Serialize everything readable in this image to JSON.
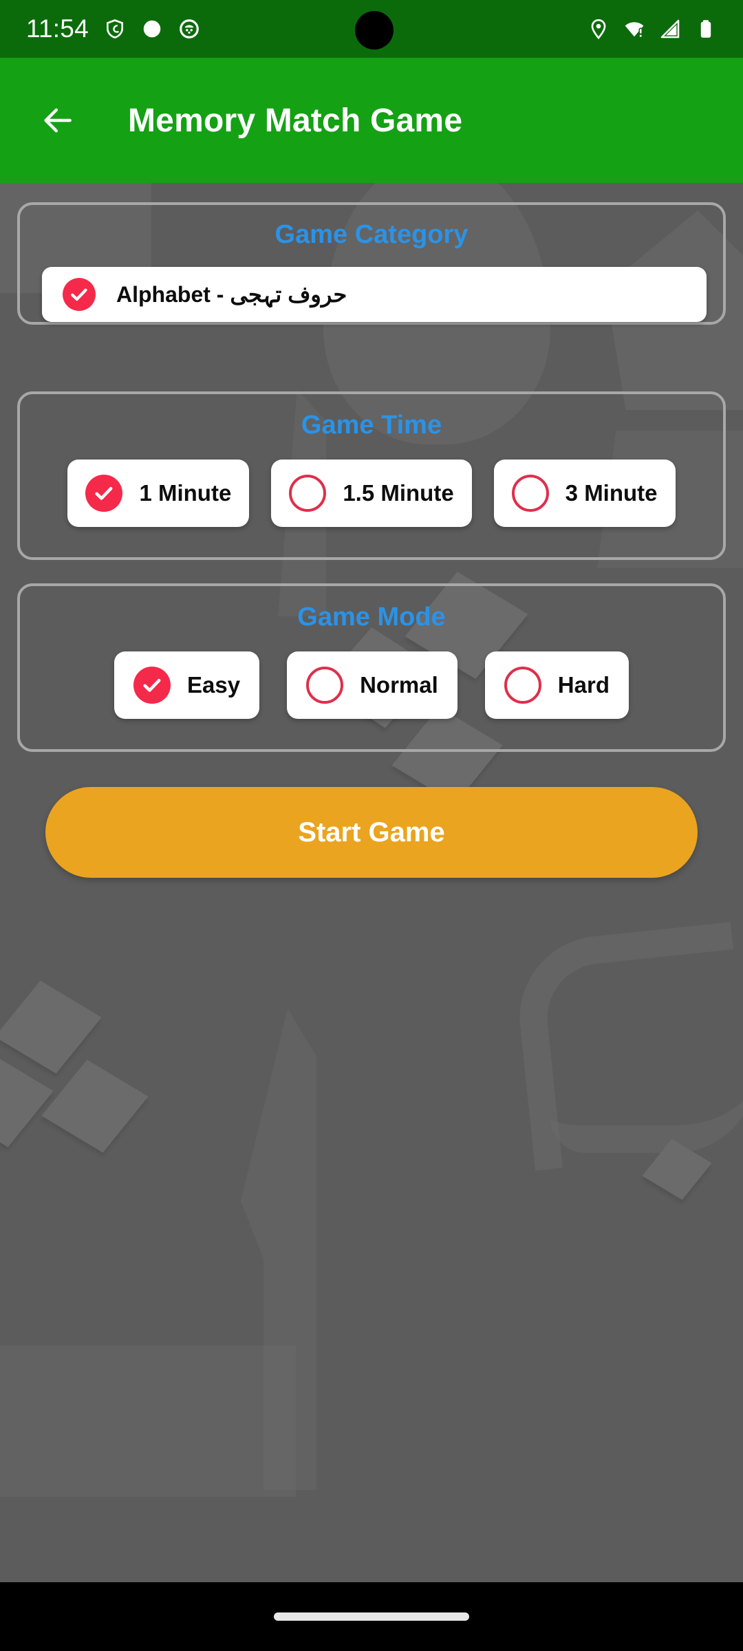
{
  "status_bar": {
    "clock": "11:54",
    "left_icons": [
      "shield-icon",
      "circle-filled-icon",
      "app-badge-icon"
    ],
    "right_icons": [
      "location-pin-icon",
      "wifi-warning-icon",
      "cell-signal-icon",
      "battery-icon"
    ]
  },
  "app_bar": {
    "back_icon": "arrow-left-icon",
    "title": "Memory Match Game",
    "background_color": "#14a114"
  },
  "sections": {
    "category": {
      "title": "Game Category",
      "options": [
        {
          "label": "Alphabet - حروف تہجی",
          "selected": true
        }
      ]
    },
    "time": {
      "title": "Game Time",
      "options": [
        {
          "label": "1 Minute",
          "selected": true
        },
        {
          "label": "1.5 Minute",
          "selected": false
        },
        {
          "label": "3 Minute",
          "selected": false
        }
      ]
    },
    "mode": {
      "title": "Game Mode",
      "options": [
        {
          "label": "Easy",
          "selected": true
        },
        {
          "label": "Normal",
          "selected": false
        },
        {
          "label": "Hard",
          "selected": false
        }
      ]
    }
  },
  "start_button": {
    "label": "Start Game",
    "color": "#eaa41f"
  },
  "colors": {
    "status_bar": "#0b6b0b",
    "app_bar": "#14a114",
    "page_background": "#5c5c5c",
    "section_heading": "#2a93e8",
    "selected_accent": "#f5294a",
    "unselected_outline": "#de2f4c",
    "card": "#ffffff"
  },
  "nav_bar": {
    "handle": "home-indicator"
  }
}
